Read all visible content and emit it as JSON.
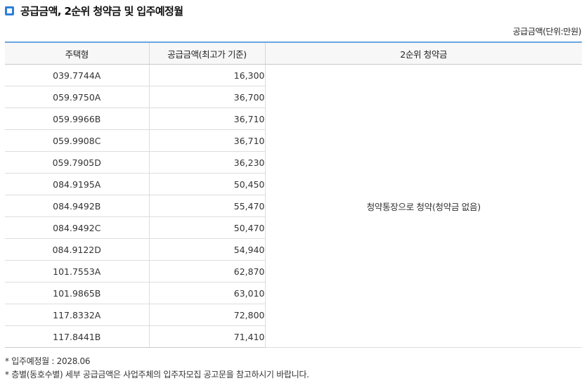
{
  "section": {
    "title": "공급금액, 2순위 청약금 및 입주예정월",
    "icon": "square-bullet-icon",
    "accent_color": "#2f7fd8"
  },
  "unit_note": "공급금액(단위:만원)",
  "table": {
    "headers": {
      "type": "주택형",
      "price": "공급금액(최고가 기준)",
      "second": "2순위 청약금"
    },
    "rows": [
      {
        "type": "039.7744A",
        "price": "16,300"
      },
      {
        "type": "059.9750A",
        "price": "36,700"
      },
      {
        "type": "059.9966B",
        "price": "36,710"
      },
      {
        "type": "059.9908C",
        "price": "36,710"
      },
      {
        "type": "059.7905D",
        "price": "36,230"
      },
      {
        "type": "084.9195A",
        "price": "50,450"
      },
      {
        "type": "084.9492B",
        "price": "55,470"
      },
      {
        "type": "084.9492C",
        "price": "50,470"
      },
      {
        "type": "084.9122D",
        "price": "54,940"
      },
      {
        "type": "101.7553A",
        "price": "62,870"
      },
      {
        "type": "101.9865B",
        "price": "63,010"
      },
      {
        "type": "117.8332A",
        "price": "72,800"
      },
      {
        "type": "117.8441B",
        "price": "71,410"
      }
    ],
    "second_value": "청약통장으로 청약(청약금 없음)"
  },
  "notes": {
    "move_in": "* 입주예정월 : 2028.06",
    "detail": "* 층별(동호수별) 세부 공급금액은 사업주체의 입주자모집 공고문을 참고하시기 바랍니다."
  }
}
